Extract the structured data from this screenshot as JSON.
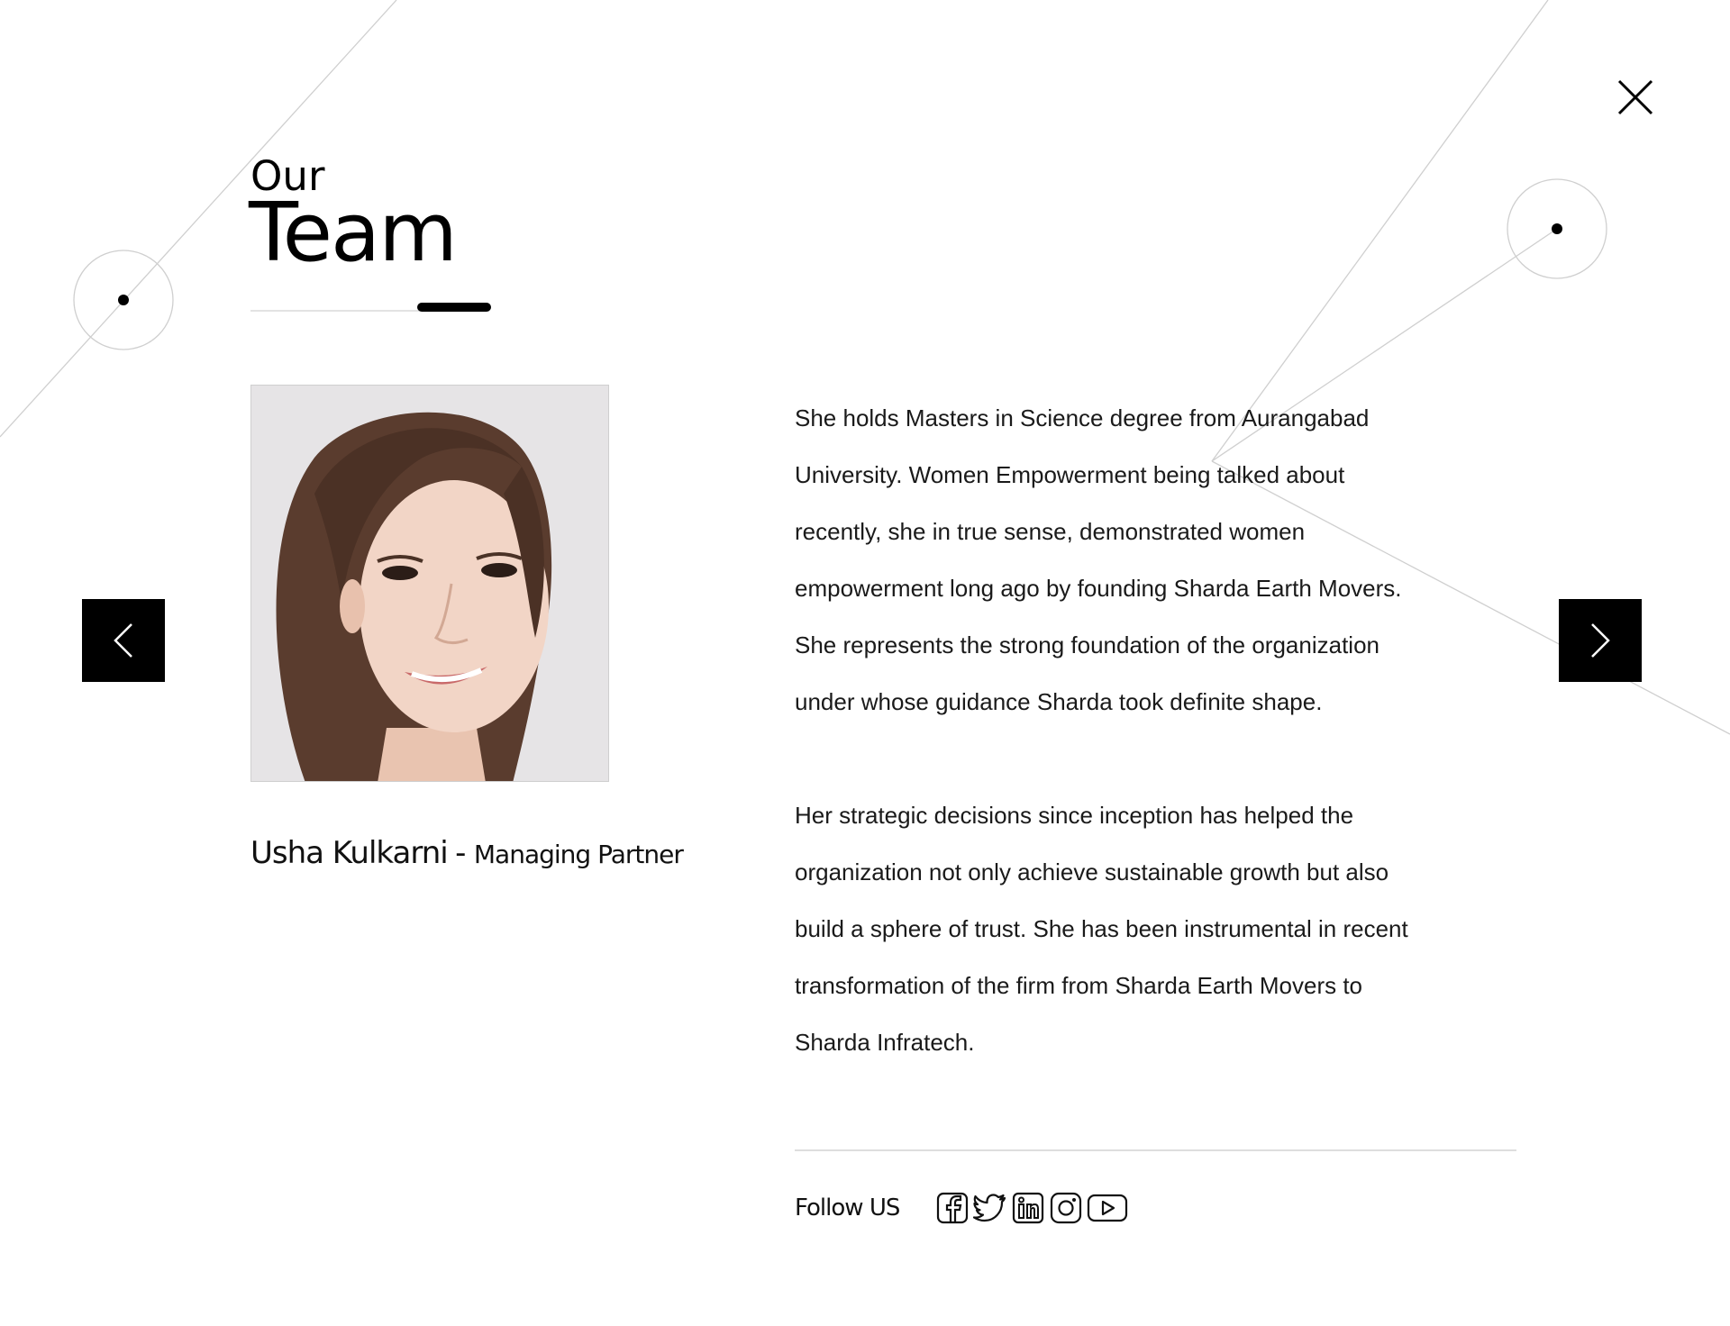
{
  "page": {
    "heading_small": "Our",
    "heading_big": "Team"
  },
  "member": {
    "name": "Usha Kulkarni",
    "separator": "-",
    "role": "Managing Partner",
    "photo_alt": "Usha Kulkarni"
  },
  "bio": {
    "paragraphs": [
      "She holds Masters in Science degree from Aurangabad University. Women Empowerment being talked about recently, she in true sense, demonstrated women empowerment long ago by founding Sharda Earth Movers. She represents the strong foundation of the organization under whose guidance Sharda took definite shape.",
      "Her strategic decisions since inception has helped the organization not only achieve sustainable growth but also build a sphere of trust. She has been instrumental in recent transformation of the firm from Sharda Earth Movers to Sharda Infratech."
    ]
  },
  "follow": {
    "label": "Follow US",
    "social": [
      {
        "name": "facebook",
        "icon": "facebook-icon"
      },
      {
        "name": "twitter",
        "icon": "twitter-icon"
      },
      {
        "name": "linkedin",
        "icon": "linkedin-icon"
      },
      {
        "name": "instagram",
        "icon": "instagram-icon"
      },
      {
        "name": "youtube",
        "icon": "youtube-icon"
      }
    ]
  },
  "controls": {
    "close_icon": "close-icon",
    "prev_icon": "chevron-left-icon",
    "next_icon": "chevron-right-icon"
  },
  "colors": {
    "background": "#ffffff",
    "text": "#111111",
    "button_bg": "#000000",
    "button_fg": "#ffffff",
    "deco_line": "#d6d6d6"
  }
}
